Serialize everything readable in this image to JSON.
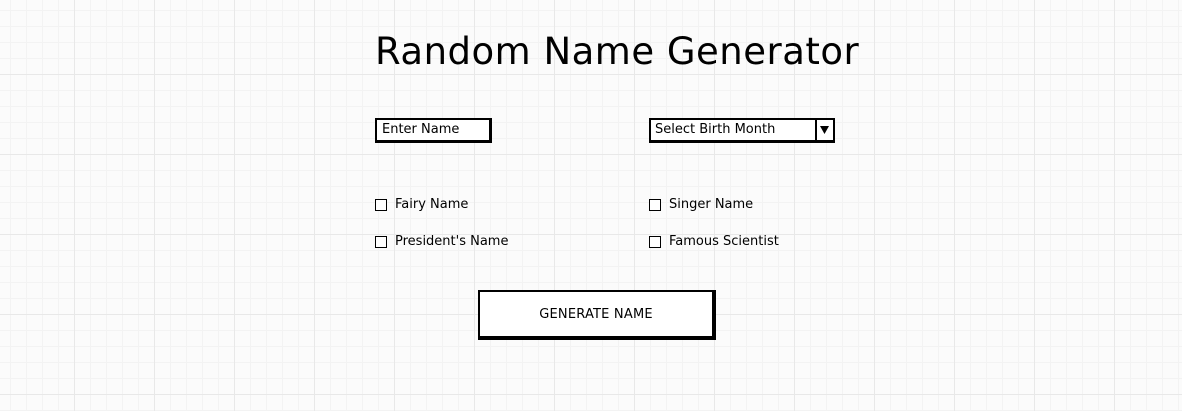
{
  "title": "Random Name Generator",
  "name_input": {
    "placeholder": "Enter Name"
  },
  "birth_month_select": {
    "selected": "Select Birth Month",
    "icon": "triangle-down-icon"
  },
  "options": {
    "fairy": "Fairy Name",
    "singer": "Singer Name",
    "president": "President's Name",
    "scientist": "Famous Scientist"
  },
  "generate_button": {
    "label": "GENERATE NAME"
  }
}
